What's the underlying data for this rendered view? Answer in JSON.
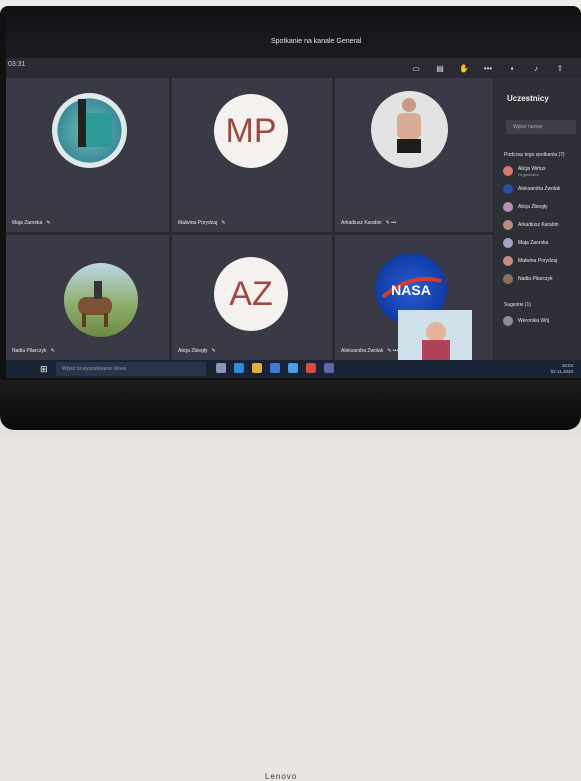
{
  "window": {
    "title": "Spotkanie na kanale General",
    "time": "03:31"
  },
  "toolbar": {
    "icons": [
      "share-screen-icon",
      "chat-icon",
      "raise-hand-icon",
      "more-options-icon",
      "camera-icon",
      "microphone-icon",
      "share-tray-icon"
    ]
  },
  "tiles": [
    {
      "name": "Maja Zaorska",
      "kind": "photo"
    },
    {
      "name": "Malwina Porydzaj",
      "initials": "MP",
      "kind": "initials"
    },
    {
      "name": "Arkadiusz Karabin",
      "kind": "photo"
    },
    {
      "name": "Nadia Pilarczyk",
      "kind": "photo"
    },
    {
      "name": "Alicja Zbiegły",
      "initials": "AZ",
      "kind": "initials"
    },
    {
      "name": "Aleksandra Zwolak",
      "kind": "photo"
    }
  ],
  "panel": {
    "title": "Uczestnicy",
    "search_placeholder": "Wpisz nazwę",
    "section_title": "Podczas tego spotkania (7)",
    "participants": [
      {
        "name": "Alicja Wirtus",
        "role": "Organizator",
        "color": "#d27a6b"
      },
      {
        "name": "Aleksandra Zwolak",
        "role": "",
        "color": "#2b4d9e"
      },
      {
        "name": "Alicja Zbiegły",
        "role": "",
        "color": "#b98fb0"
      },
      {
        "name": "Arkadiusz Karabin",
        "role": "",
        "color": "#b78f7c"
      },
      {
        "name": "Maja Zaorska",
        "role": "",
        "color": "#9fa6c7"
      },
      {
        "name": "Malwina Porydzaj",
        "role": "",
        "color": "#c68f83"
      },
      {
        "name": "Nadia Pilarczyk",
        "role": "",
        "color": "#8a6f60"
      }
    ],
    "suggested_title": "Sugestie (1)",
    "suggested": [
      {
        "name": "Weronika Wój",
        "color": "#8b8e97"
      }
    ]
  },
  "taskbar": {
    "search_placeholder": "Wpisz tu wyszukiwane słowa",
    "time": "18:04",
    "date": "02.11.2020"
  },
  "photo": {
    "brand": "Lenovo"
  },
  "colors": {
    "teams_dark": "#2a2a33",
    "tile": "#3a3a46",
    "accent_red": "#cc4a31",
    "initials_text": "#9b4a41"
  }
}
